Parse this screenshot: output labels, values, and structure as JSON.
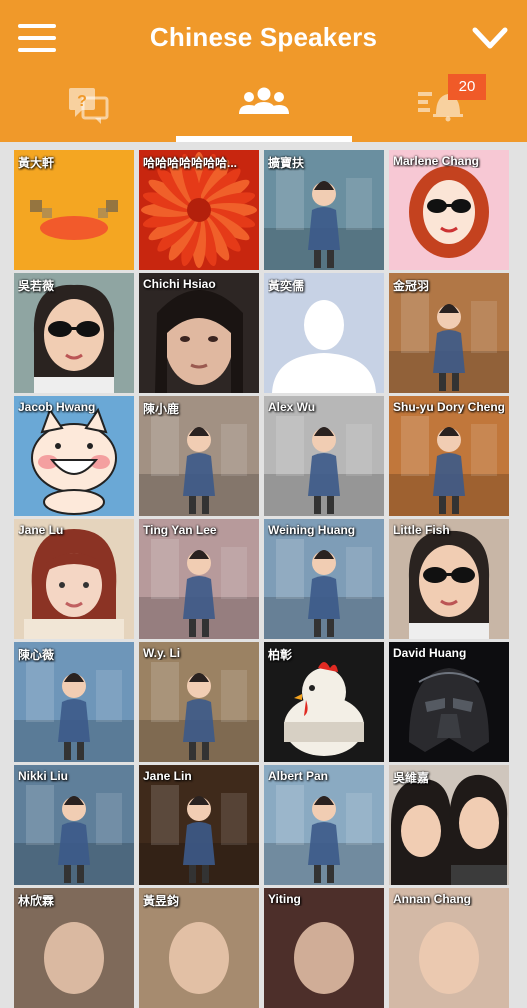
{
  "header": {
    "title": "Chinese Speakers",
    "menu_icon": "hamburger-menu-icon",
    "dropdown_icon": "chevron-down-icon",
    "background": "#f0992a"
  },
  "tabs": [
    {
      "icon": "question-chat-icon",
      "active": false
    },
    {
      "icon": "people-group-icon",
      "active": true
    },
    {
      "icon": "notification-bell-list-icon",
      "active": false,
      "badge": "20"
    }
  ],
  "members": [
    {
      "name": "黃大軒",
      "bg": "#f3a722",
      "photo": "duck"
    },
    {
      "name": "哈哈哈哈哈哈哈...",
      "bg": "#e4431d",
      "photo": "flower"
    },
    {
      "name": "擴寶扶",
      "bg": "#6a8fa0",
      "photo": "person-yellow"
    },
    {
      "name": "Marlene Chang",
      "bg": "#f6c7d2",
      "photo": "cartoon-girl"
    },
    {
      "name": "吳若薇",
      "bg": "#8fa5a2",
      "photo": "person-sunglasses"
    },
    {
      "name": "Chichi Hsiao",
      "bg": "#3a3330",
      "photo": "face-dark"
    },
    {
      "name": "黃奕儒",
      "bg": "#c5d0e3",
      "photo": "silhouette"
    },
    {
      "name": "金冠羽",
      "bg": "#b17746",
      "photo": "person-drinks"
    },
    {
      "name": "Jacob Hwang",
      "bg": "#6aa6d2",
      "photo": "cartoon-cat"
    },
    {
      "name": "陳小鹿",
      "bg": "#a29183",
      "photo": "person-cake"
    },
    {
      "name": "Alex Wu",
      "bg": "#b7b7b7",
      "photo": "couple-bw"
    },
    {
      "name": "Shu-yu Dory Cheng",
      "bg": "#c1773b",
      "photo": "person-wall"
    },
    {
      "name": "Jane Lu",
      "bg": "#d9c0a4",
      "photo": "face-redhair"
    },
    {
      "name": "Ting Yan Lee",
      "bg": "#b79a9b",
      "photo": "person-city"
    },
    {
      "name": "Weining Huang",
      "bg": "#7e9db7",
      "photo": "person-colosseum"
    },
    {
      "name": "Little Fish",
      "bg": "#c8b6a6",
      "photo": "face-sunglasses"
    },
    {
      "name": "陳心薇",
      "bg": "#6e96b9",
      "photo": "person-jump"
    },
    {
      "name": "W.y. Li",
      "bg": "#9b8263",
      "photo": "person-flowers"
    },
    {
      "name": "柏彰",
      "bg": "#1a1a1a",
      "photo": "chicken-timer"
    },
    {
      "name": "David Huang",
      "bg": "#0e0e10",
      "photo": "darth-vader"
    },
    {
      "name": "Nikki Liu",
      "bg": "#5f7f9a",
      "photo": "person-house"
    },
    {
      "name": "Jane Lin",
      "bg": "#3f2a1b",
      "photo": "person-shop"
    },
    {
      "name": "Albert Pan",
      "bg": "#8aaac2",
      "photo": "person-river"
    },
    {
      "name": "吳維嘉",
      "bg": "#c9c0b8",
      "photo": "two-girls"
    },
    {
      "name": "林欣霖",
      "bg": "#7f6a5a",
      "photo": "partial"
    },
    {
      "name": "黃昱鈞",
      "bg": "#a68b6f",
      "photo": "partial"
    },
    {
      "name": "Yiting",
      "bg": "#4d2f2a",
      "photo": "partial"
    },
    {
      "name": "Annan Chang",
      "bg": "#d3b9a6",
      "photo": "partial"
    }
  ]
}
